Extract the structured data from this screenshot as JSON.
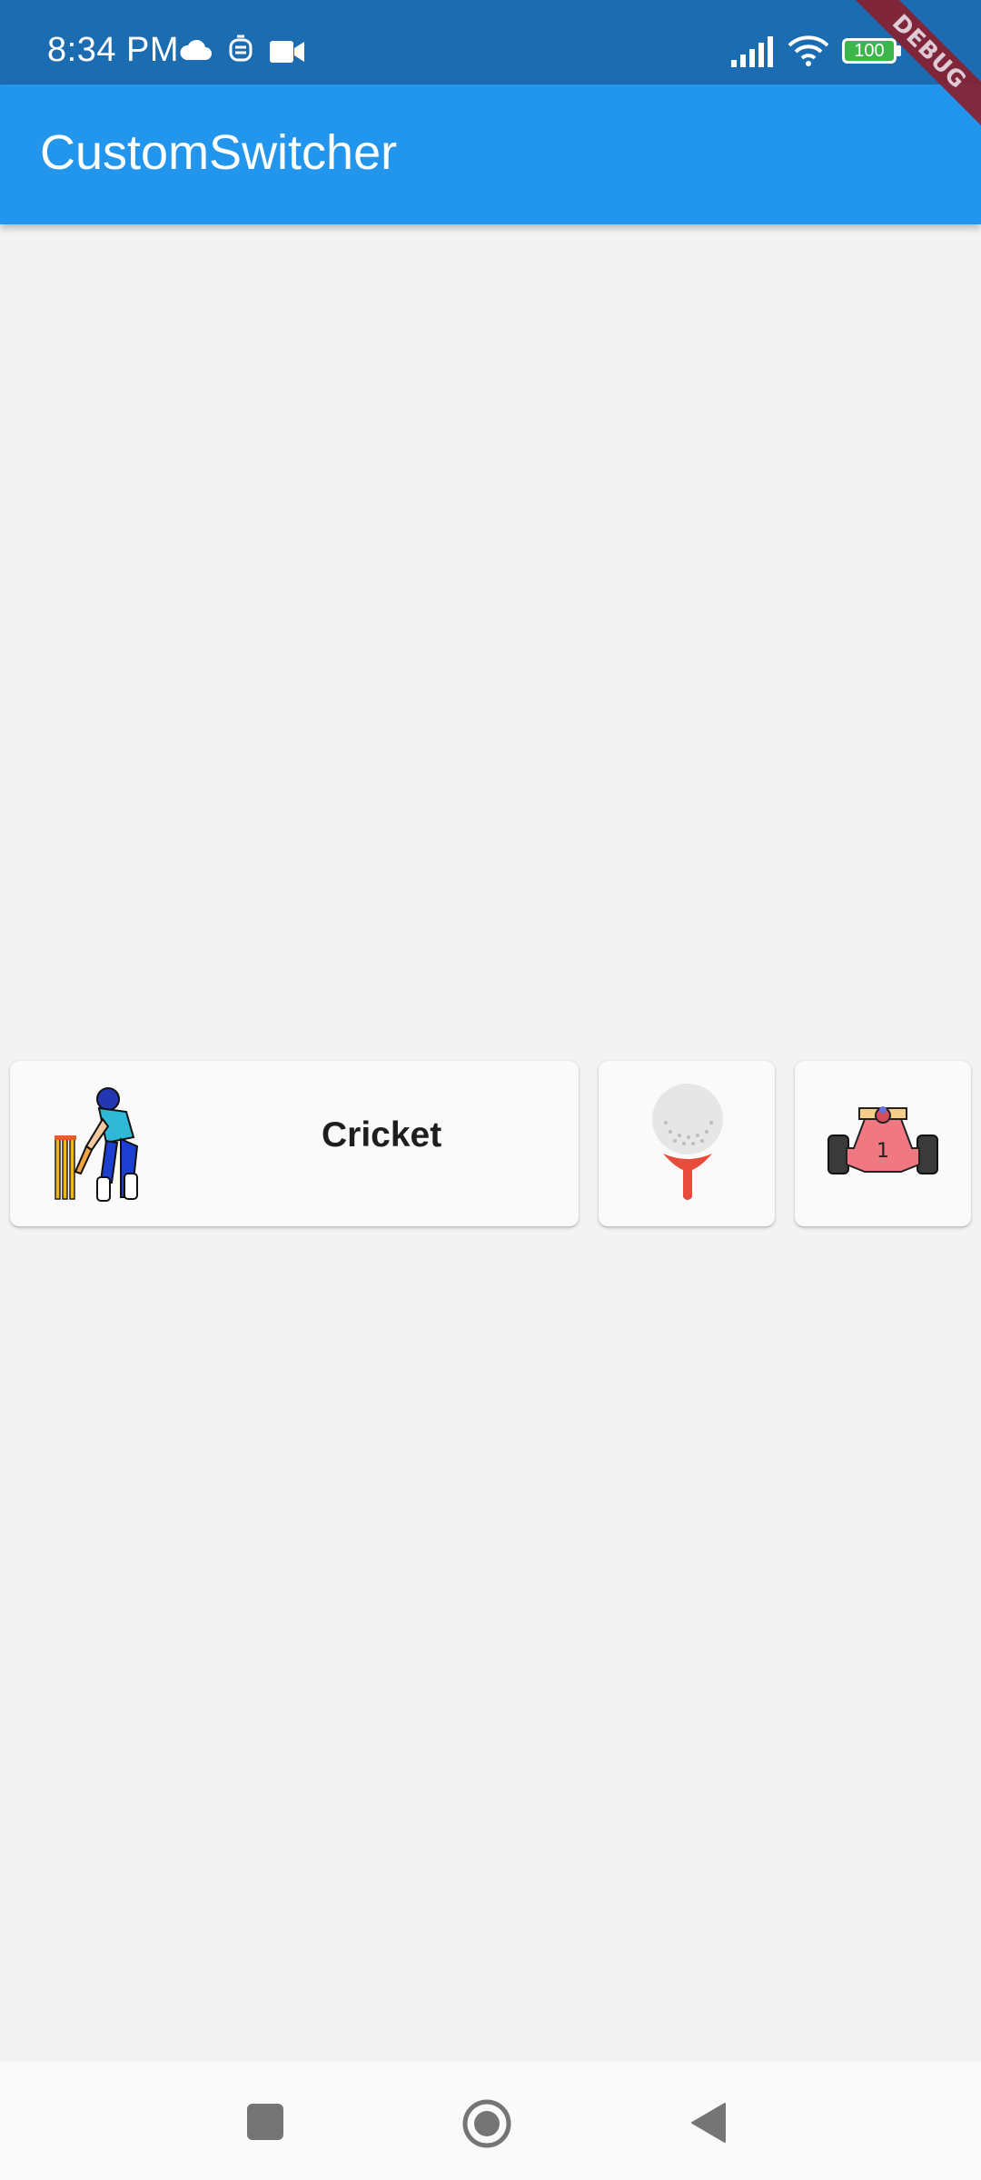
{
  "status_bar": {
    "time": "8:34 PM",
    "battery": "100",
    "icons": [
      "cloud-icon",
      "notification-icon",
      "video-camera-icon",
      "signal-icon",
      "wifi-icon",
      "battery-icon"
    ]
  },
  "app_bar": {
    "title": "CustomSwitcher"
  },
  "debug_banner": {
    "label": "DEBUG"
  },
  "switcher": {
    "items": [
      {
        "label": "Cricket",
        "icon": "cricket-batsman-icon",
        "selected": true
      },
      {
        "label": "",
        "icon": "golf-ball-tee-icon",
        "selected": false
      },
      {
        "label": "",
        "icon": "race-car-icon",
        "selected": false
      }
    ]
  },
  "nav_bar": {
    "icons": [
      "recent-apps-icon",
      "home-icon",
      "back-icon"
    ]
  },
  "colors": {
    "status_bar": "#1c6cb2",
    "app_bar": "#2295ec",
    "background": "#f3f3f3",
    "debug": "#8b1f2f"
  }
}
